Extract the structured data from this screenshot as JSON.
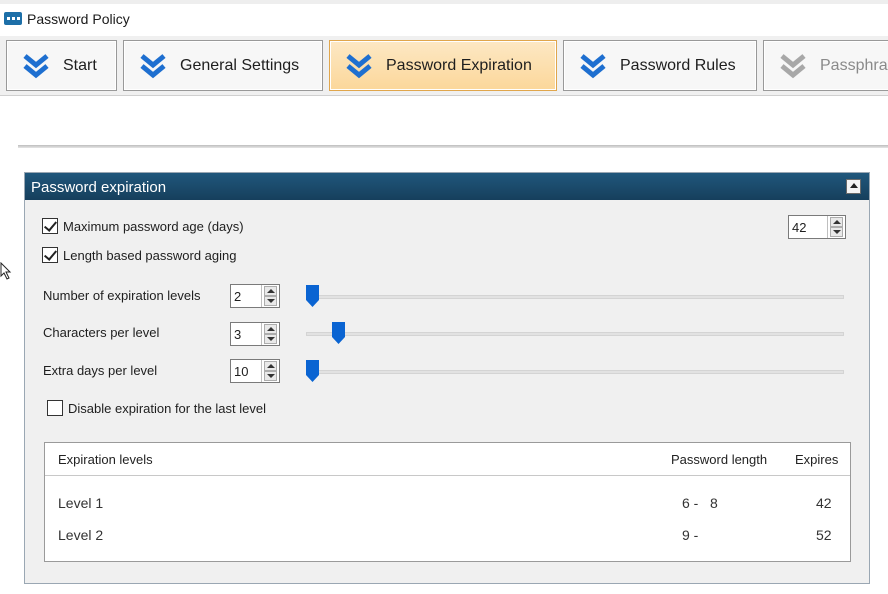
{
  "window": {
    "title": "Password Policy"
  },
  "tabs": [
    {
      "label": "Start",
      "state": "normal"
    },
    {
      "label": "General Settings",
      "state": "normal"
    },
    {
      "label": "Password Expiration",
      "state": "active"
    },
    {
      "label": "Password Rules",
      "state": "normal"
    },
    {
      "label": "Passphrase",
      "state": "disabled"
    }
  ],
  "panel": {
    "title": "Password expiration",
    "max_age": {
      "label": "Maximum password age (days)",
      "checked": true,
      "value": "42"
    },
    "length_aging": {
      "label": "Length based password aging",
      "checked": true
    },
    "expiration_levels": {
      "label": "Number of expiration levels",
      "value": "2",
      "slider_fraction": 0.0
    },
    "chars_per_level": {
      "label": "Characters per level",
      "value": "3",
      "slider_fraction": 0.05
    },
    "extra_days": {
      "label": "Extra days per level",
      "value": "10",
      "slider_fraction": 0.0
    },
    "disable_last": {
      "label": "Disable expiration for the last level",
      "checked": false
    },
    "levels_table": {
      "headers": {
        "level": "Expiration levels",
        "length": "Password length",
        "expires": "Expires"
      },
      "rows": [
        {
          "level": "Level 1",
          "length": "6 -   8",
          "expires": "42"
        },
        {
          "level": "Level 2",
          "length": "9 -",
          "expires": "52"
        }
      ]
    }
  },
  "colors": {
    "panel_header": "#1b4a6b",
    "active_tab": "#fbd79a",
    "chevron_blue": "#1e6fd0",
    "slider_thumb": "#0a64d2"
  }
}
